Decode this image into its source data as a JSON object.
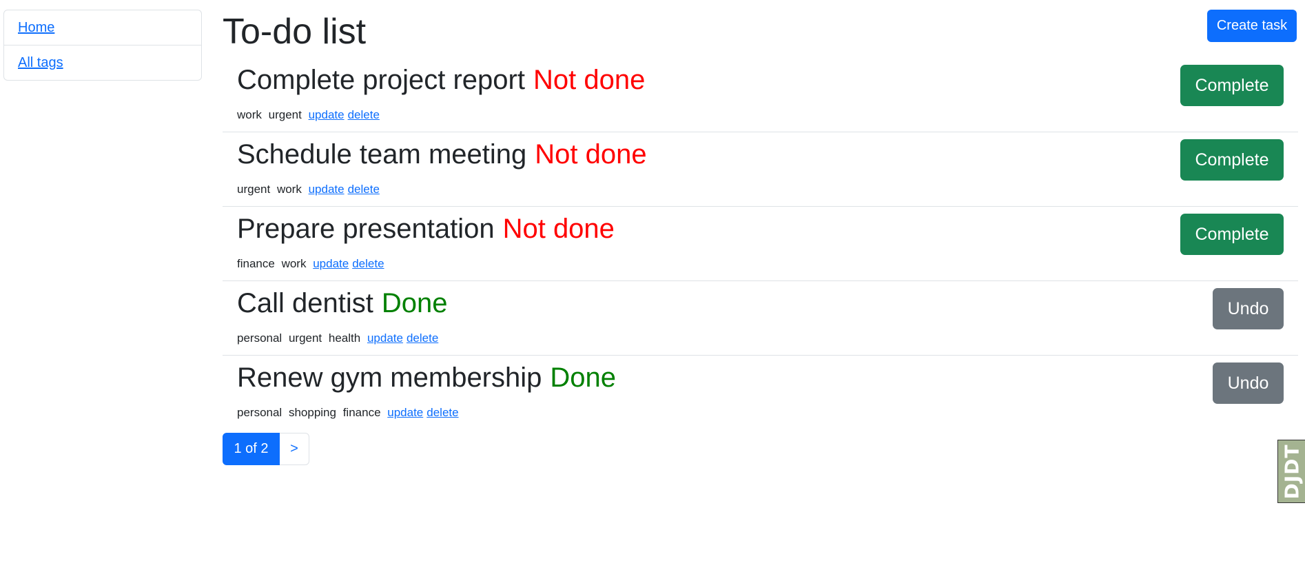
{
  "sidebar": {
    "items": [
      {
        "label": "Home"
      },
      {
        "label": "All tags"
      }
    ]
  },
  "header": {
    "title": "To-do list",
    "create_button": "Create task"
  },
  "tasks": [
    {
      "title": "Complete project report",
      "status": "Not done",
      "tags": [
        "work",
        "urgent"
      ],
      "update_label": "update",
      "delete_label": "delete",
      "action_label": "Complete"
    },
    {
      "title": "Schedule team meeting",
      "status": "Not done",
      "tags": [
        "urgent",
        "work"
      ],
      "update_label": "update",
      "delete_label": "delete",
      "action_label": "Complete"
    },
    {
      "title": "Prepare presentation",
      "status": "Not done",
      "tags": [
        "finance",
        "work"
      ],
      "update_label": "update",
      "delete_label": "delete",
      "action_label": "Complete"
    },
    {
      "title": "Call dentist",
      "status": "Done",
      "tags": [
        "personal",
        "urgent",
        "health"
      ],
      "update_label": "update",
      "delete_label": "delete",
      "action_label": "Undo"
    },
    {
      "title": "Renew gym membership",
      "status": "Done",
      "tags": [
        "personal",
        "shopping",
        "finance"
      ],
      "update_label": "update",
      "delete_label": "delete",
      "action_label": "Undo"
    }
  ],
  "pagination": {
    "current": "1 of 2",
    "next": ">"
  },
  "debug_toolbar": {
    "label": "DJDT"
  },
  "colors": {
    "primary": "#0d6efd",
    "success": "#198754",
    "secondary": "#6c757d",
    "not_done": "#ff0000",
    "done": "#008000"
  }
}
